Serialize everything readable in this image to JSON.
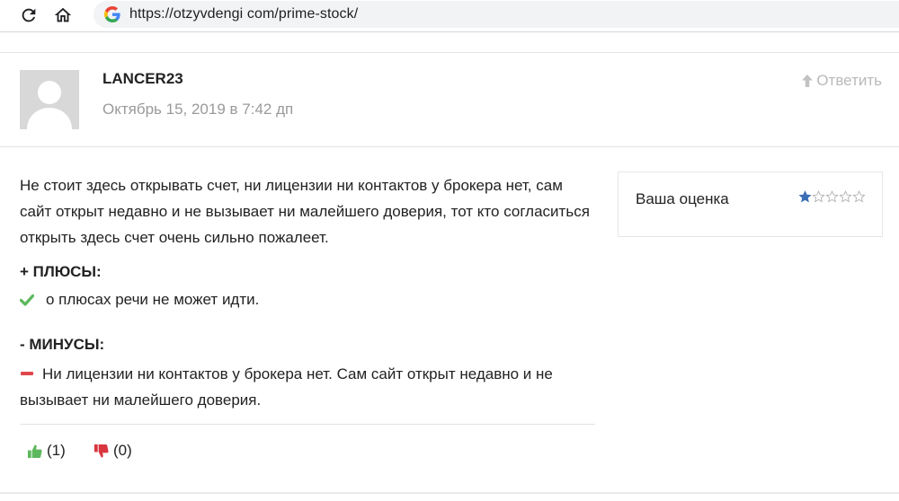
{
  "browser": {
    "url": "https://otzyvdengi com/prime-stock/",
    "reload_icon": "reload-icon",
    "home_icon": "home-icon",
    "site_icon": "google-icon"
  },
  "comment": {
    "author": "LANCER23",
    "date": "Октябрь 15, 2019 в 7:42 дп",
    "reply_label": "Ответить",
    "text": "Не стоит здесь открывать счет, ни лицензии ни контактов у брокера нет, сам сайт открыт недавно и не вызывает ни малейшего доверия, тот кто согласиться открыть здесь счет очень сильно пожалеет.",
    "pros_title": "+ ПЛЮСЫ:",
    "pros_item": "о плюсах речи не может идти.",
    "cons_title": "- МИНУСЫ:",
    "cons_item": "Ни лицензии ни контактов у брокера нет. Сам сайт открыт недавно и не вызывает ни малейшего доверия.",
    "votes_up": "(1)",
    "votes_down": "(0)"
  },
  "rating": {
    "label": "Ваша оценка",
    "value": 1,
    "max": 5
  },
  "colors": {
    "check": "#5cb85c",
    "minus": "#e0474c",
    "thumb_up": "#5cb85c",
    "thumb_down": "#d9363e",
    "star_fill": "#3b6fb6"
  }
}
